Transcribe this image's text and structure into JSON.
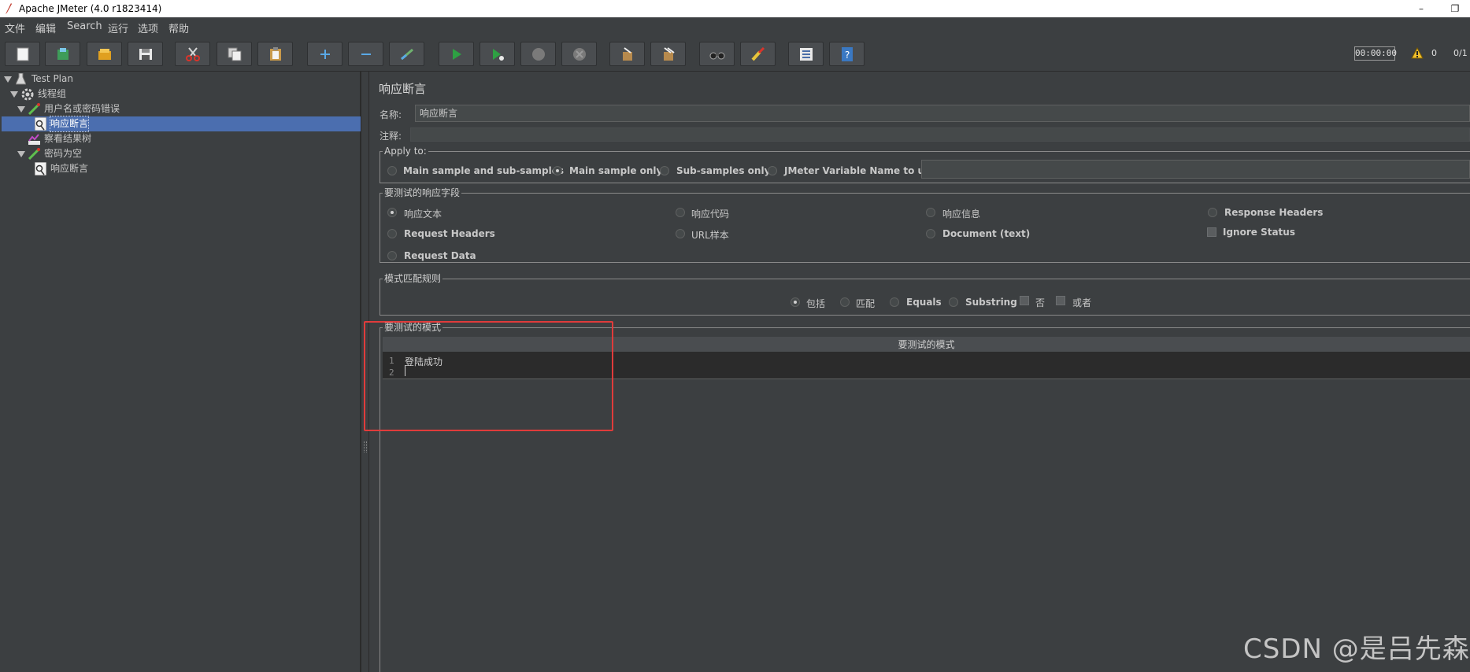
{
  "window": {
    "title": "Apache JMeter (4.0 r1823414)"
  },
  "menu": [
    "文件",
    "编辑",
    "Search",
    "运行",
    "选项",
    "帮助"
  ],
  "toolbar": {
    "buttons": [
      "new-icon",
      "templates-icon",
      "open-icon",
      "save-icon",
      "cut-icon",
      "copy-icon",
      "paste-icon",
      "expand-icon",
      "collapse-icon",
      "toggle-icon",
      "start-icon",
      "start-no-pause-icon",
      "stop-icon",
      "shutdown-icon",
      "clear-icon",
      "clear-all-icon",
      "search-icon",
      "reset-search-icon",
      "function-helper-icon",
      "help-icon"
    ],
    "timer": "00:00:00",
    "warnings": "0",
    "threads": "0/1"
  },
  "tree": {
    "items": [
      {
        "label": "Test Plan",
        "icon": "test-plan-icon"
      },
      {
        "label": "线程组",
        "icon": "thread-group-icon"
      },
      {
        "label": "用户名或密码错误",
        "icon": "sampler-icon"
      },
      {
        "label": "响应断言",
        "icon": "assertion-icon"
      },
      {
        "label": "察看结果树",
        "icon": "listener-icon"
      },
      {
        "label": "密码为空",
        "icon": "sampler-icon"
      },
      {
        "label": "响应断言",
        "icon": "assertion-icon"
      }
    ]
  },
  "panel": {
    "title": "响应断言",
    "name_label": "名称:",
    "name_value": "响应断言",
    "comment_label": "注释:",
    "apply_to": {
      "title": "Apply to:",
      "options": [
        "Main sample and sub-samples",
        "Main sample only",
        "Sub-samples only",
        "JMeter Variable Name to use"
      ],
      "selected": "Main sample only"
    },
    "field_to_test": {
      "title": "要测试的响应字段",
      "options": [
        "响应文本",
        "响应代码",
        "响应信息",
        "Response Headers",
        "Request Headers",
        "URL样本",
        "Document (text)",
        "Ignore Status",
        "Request Data"
      ],
      "selected": "响应文本"
    },
    "pattern_rule": {
      "title": "模式匹配规则",
      "options": [
        "包括",
        "匹配",
        "Equals",
        "Substring",
        "否",
        "或者"
      ],
      "selected": "包括"
    },
    "patterns": {
      "title": "要测试的模式",
      "column": "要测试的模式",
      "lines": [
        "登陆成功",
        ""
      ],
      "line_numbers": [
        "1",
        "2"
      ]
    }
  },
  "watermark": "CSDN @是吕先森",
  "colors": {
    "selection": "#4b6eaf",
    "highlight_box": "#e03b3b",
    "background": "#3c3f41"
  }
}
